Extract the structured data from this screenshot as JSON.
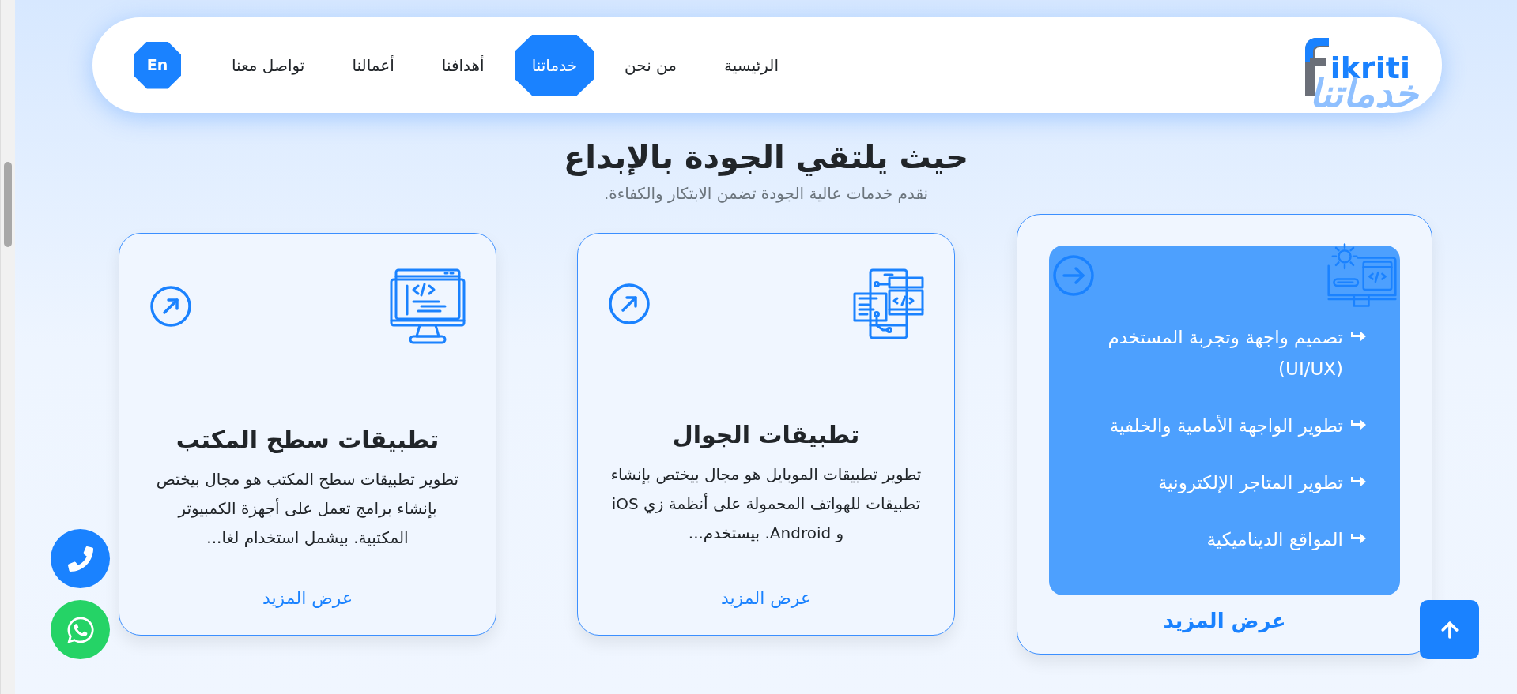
{
  "navbar": {
    "logo": "ikriti",
    "items": [
      {
        "label": "الرئيسية",
        "selected": false
      },
      {
        "label": "من نحن",
        "selected": false
      },
      {
        "label": "خدماتنا",
        "selected": true
      },
      {
        "label": "أهدافنا",
        "selected": false
      },
      {
        "label": "أعمالنا",
        "selected": false
      },
      {
        "label": "تواصل معنا",
        "selected": false
      }
    ],
    "language_button": "En"
  },
  "section_watermark": "خدماتنا",
  "heading": "حيث يلتقي الجودة بالإبداع",
  "subheading": "نقدم خدمات عالية الجودة تضمن الابتكار والكفاءة.",
  "cards": [
    {
      "kind": "web",
      "expanded": true,
      "link": "عرض المزيد",
      "features": [
        "تصميم واجهة وتجربة المستخدم (UI/UX)",
        "تطوير الواجهة الأمامية والخلفية",
        "تطوير المتاجر الإلكترونية",
        "المواقع الديناميكية"
      ]
    },
    {
      "kind": "mobile",
      "expanded": false,
      "title": "تطبيقات الجوال",
      "description": "تطوير تطبيقات الموبايل هو مجال بيختص بإنشاء تطبيقات للهواتف المحمولة على أنظمة زي iOS و Android. بيستخدم...",
      "link": "عرض المزيد"
    },
    {
      "kind": "desktop",
      "expanded": false,
      "title": "تطبيقات سطح المكتب",
      "description": "تطوير تطبيقات سطح المكتب هو مجال بيختص بإنشاء برامج تعمل على أجهزة الكمبيوتر المكتبية. بيشمل استخدام لغا...",
      "link": "عرض المزيد"
    }
  ]
}
